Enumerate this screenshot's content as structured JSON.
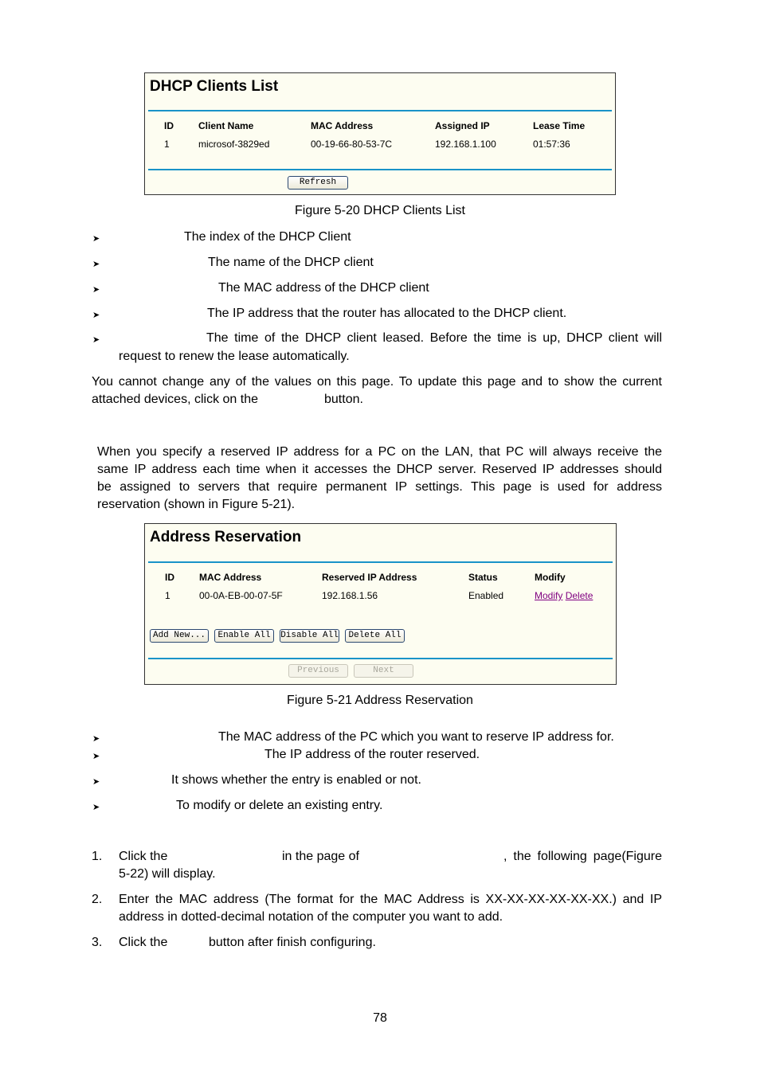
{
  "dhcp_panel": {
    "title": "DHCP Clients List",
    "columns": [
      "ID",
      "Client Name",
      "MAC Address",
      "Assigned IP",
      "Lease Time"
    ],
    "rows": [
      [
        "1",
        "microsof-3829ed",
        "00-19-66-80-53-7C",
        "192.168.1.100",
        "01:57:36"
      ]
    ],
    "refresh_label": "Refresh"
  },
  "figure_20_caption": "Figure 5-20 DHCP Clients List",
  "dhcp_bullets": [
    "The index of the DHCP Client",
    "The name of the DHCP client",
    "The MAC address of the DHCP client",
    "The IP address that the router has allocated to the DHCP client.",
    "The time of the DHCP client leased. Before the time is up, DHCP client will",
    "request to renew the lease automatically."
  ],
  "note_paragraph": {
    "line1": "You cannot change any of the values on this page. To update this page and to show the current",
    "line2a": "attached devices, click on the",
    "line2b": "button."
  },
  "reservation_intro": [
    "When you specify a reserved IP address for a PC on the LAN, that PC will always receive the",
    "same IP address each time when it accesses the DHCP server. Reserved IP addresses should",
    "be assigned to servers that require permanent IP settings. This page is used for address",
    "reservation (shown in Figure 5-21)."
  ],
  "reservation_panel": {
    "title": "Address Reservation",
    "columns": [
      "ID",
      "MAC Address",
      "Reserved IP Address",
      "Status",
      "Modify"
    ],
    "rows": [
      {
        "id": "1",
        "mac": "00-0A-EB-00-07-5F",
        "ip": "192.168.1.56",
        "status": "Enabled",
        "modify_link": "Modify",
        "delete_link": "Delete"
      }
    ],
    "buttons": {
      "add_new": "Add New...",
      "enable_all": "Enable All",
      "disable_all": "Disable All",
      "delete_all": "Delete All",
      "previous": "Previous",
      "next": "Next"
    },
    "link_color": "#800080",
    "rule_color": "#1993c8",
    "panel_bg": "#fdfdf1"
  },
  "figure_21_caption": "Figure 5-21 Address Reservation",
  "reservation_bullets": [
    "The MAC address of the PC which you want to reserve IP address for.",
    "The IP address of the router reserved.",
    "It shows whether the entry is enabled or not.",
    "To modify or delete an existing entry."
  ],
  "steps": [
    {
      "num": "1.",
      "parts": [
        "Click the",
        "in the page of",
        ", the following page(Figure"
      ],
      "cont": "5-22) will display."
    },
    {
      "num": "2.",
      "line": "Enter the MAC address (The format for the MAC Address is XX-XX-XX-XX-XX-XX.) and IP",
      "cont": "address in dotted-decimal notation of the computer you want to add."
    },
    {
      "num": "3.",
      "parts": [
        "Click the",
        "button after finish configuring."
      ]
    }
  ],
  "page_number": "78",
  "bullet_icon": "arrowhead-bullet"
}
